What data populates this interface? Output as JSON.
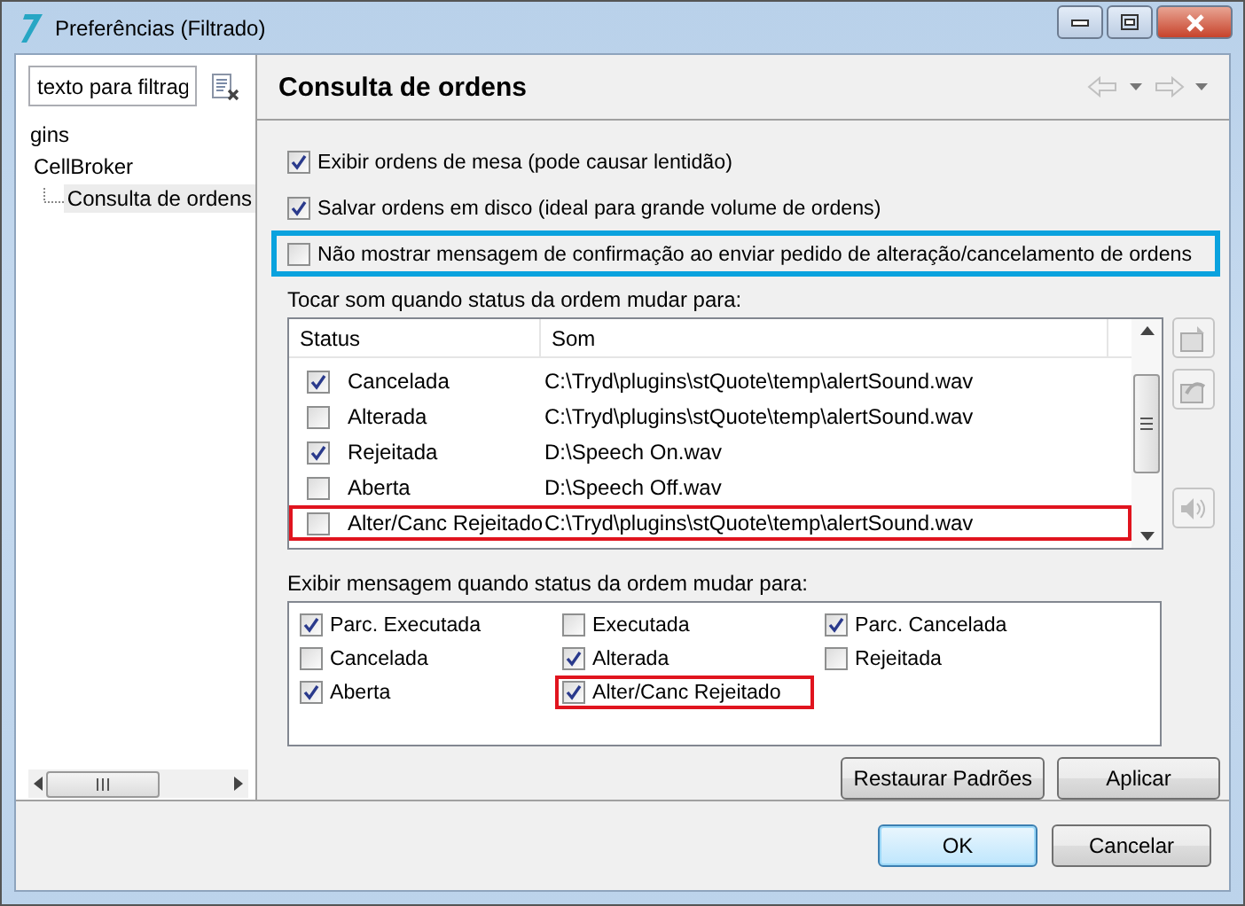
{
  "window": {
    "title": "Preferências (Filtrado)"
  },
  "sidebar": {
    "filter": {
      "value": "texto para filtrag"
    },
    "tree": [
      {
        "label": "gins",
        "selected": false
      },
      {
        "label": "CellBroker",
        "selected": false,
        "children": [
          {
            "label": "Consulta de ordens",
            "selected": true
          }
        ]
      }
    ]
  },
  "page": {
    "title": "Consulta de ordens"
  },
  "options": [
    {
      "label": "Exibir ordens de mesa (pode causar lentidão)",
      "checked": true,
      "highlighted": false
    },
    {
      "label": "Salvar ordens em disco (ideal para grande volume de ordens)",
      "checked": true,
      "highlighted": false
    },
    {
      "label": "Não mostrar mensagem de confirmação ao enviar pedido de alteração/cancelamento de ordens",
      "checked": false,
      "highlighted": true
    }
  ],
  "sound_table": {
    "label": "Tocar som quando status da ordem mudar para:",
    "columns": [
      "Status",
      "Som"
    ],
    "rows": [
      {
        "status": "Cancelada",
        "sound": "C:\\Tryd\\plugins\\stQuote\\temp\\alertSound.wav",
        "checked": true,
        "highlighted": false
      },
      {
        "status": "Alterada",
        "sound": "C:\\Tryd\\plugins\\stQuote\\temp\\alertSound.wav",
        "checked": false,
        "highlighted": false
      },
      {
        "status": "Rejeitada",
        "sound": "D:\\Speech On.wav",
        "checked": true,
        "highlighted": false
      },
      {
        "status": "Aberta",
        "sound": "D:\\Speech Off.wav",
        "checked": false,
        "highlighted": false
      },
      {
        "status": "Alter/Canc Rejeitado",
        "sound": "C:\\Tryd\\plugins\\stQuote\\temp\\alertSound.wav",
        "checked": false,
        "highlighted": true
      }
    ]
  },
  "message_group": {
    "label": "Exibir mensagem quando status da ordem mudar para:",
    "options": [
      {
        "label": "Parc. Executada",
        "checked": true,
        "highlighted": false
      },
      {
        "label": "Executada",
        "checked": false,
        "highlighted": false
      },
      {
        "label": "Parc. Cancelada",
        "checked": true,
        "highlighted": false
      },
      {
        "label": "Cancelada",
        "checked": false,
        "highlighted": false
      },
      {
        "label": "Alterada",
        "checked": true,
        "highlighted": false
      },
      {
        "label": "Rejeitada",
        "checked": false,
        "highlighted": false
      },
      {
        "label": "Aberta",
        "checked": true,
        "highlighted": false
      },
      {
        "label": "Alter/Canc Rejeitado",
        "checked": true,
        "highlighted": true
      }
    ]
  },
  "page_buttons": [
    "Restaurar Padrões",
    "Aplicar"
  ],
  "dialog_buttons": [
    {
      "label": "OK",
      "default": true
    },
    {
      "label": "Cancelar",
      "default": false
    }
  ]
}
